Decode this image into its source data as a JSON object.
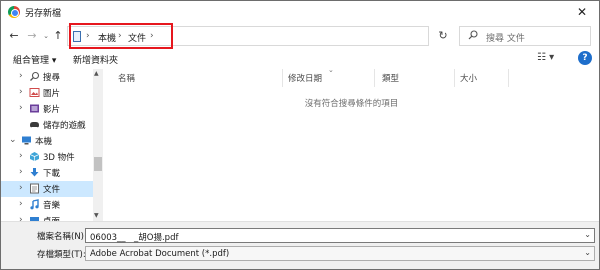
{
  "window": {
    "title": "另存新檔",
    "close_label": "✕"
  },
  "address": {
    "back_label": "←",
    "forward_label": "→",
    "history_label": "⌄",
    "up_label": "↑",
    "breadcrumbs": [
      "本機",
      "文件"
    ],
    "separator": "›",
    "refresh_label": "↻",
    "dropdown_label": "⌄"
  },
  "search": {
    "placeholder": "搜尋 文件"
  },
  "toolbar": {
    "organize_label": "組合管理 ▾",
    "new_folder_label": "新增資料夾",
    "view_label": "☷ ▾",
    "help_label": "?"
  },
  "nav": {
    "items": [
      {
        "label": "搜尋",
        "chevron": "›",
        "icon": "search-icon",
        "indent": 0
      },
      {
        "label": "圖片",
        "chevron": "›",
        "icon": "pictures-icon",
        "indent": 0
      },
      {
        "label": "影片",
        "chevron": "›",
        "icon": "videos-icon",
        "indent": 0
      },
      {
        "label": "儲存的遊戲",
        "chevron": "",
        "icon": "saved-games-icon",
        "indent": 0
      },
      {
        "label": "本機",
        "chevron": "⌄",
        "icon": "this-pc-icon",
        "indent": -1
      },
      {
        "label": "3D 物件",
        "chevron": "›",
        "icon": "3d-objects-icon",
        "indent": 0
      },
      {
        "label": "下載",
        "chevron": "›",
        "icon": "downloads-icon",
        "indent": 0
      },
      {
        "label": "文件",
        "chevron": "›",
        "icon": "documents-icon",
        "indent": 0,
        "selected": true
      },
      {
        "label": "音樂",
        "chevron": "›",
        "icon": "music-icon",
        "indent": 0
      },
      {
        "label": "桌面",
        "chevron": "›",
        "icon": "desktop-icon",
        "indent": 0
      }
    ]
  },
  "columns": [
    "名稱",
    "修改日期",
    "類型",
    "大小"
  ],
  "empty_message": "沒有符合搜尋條件的項目",
  "filename": {
    "label": "檔案名稱(N):",
    "value": "06003__　_胡O揚.pdf"
  },
  "filetype": {
    "label": "存檔類型(T):",
    "value": "Adobe Acrobat Document (*.pdf)"
  },
  "colors": {
    "highlight": "#e6171e",
    "selected": "#cce8ff",
    "help": "#1e6ecb"
  }
}
